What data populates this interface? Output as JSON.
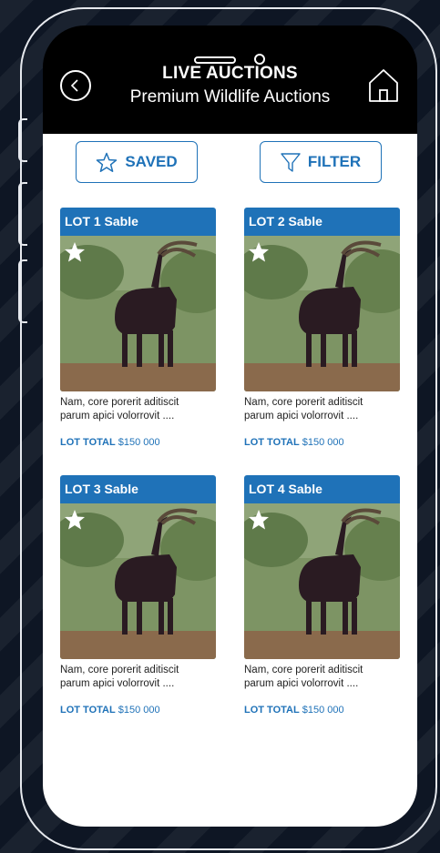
{
  "header": {
    "title": "LIVE AUCTIONS",
    "subtitle": "Premium Wildlife Auctions",
    "back_icon": "chevron-left-icon",
    "home_icon": "home-icon"
  },
  "toolbar": {
    "saved_label": "SAVED",
    "filter_label": "FILTER"
  },
  "lots": [
    {
      "title": "LOT 1 Sable",
      "desc_line1": "Nam, core porerit aditiscit",
      "desc_line2": "parum apici volorrovit ....",
      "total_label": "LOT TOTAL",
      "total_value": "$150 000"
    },
    {
      "title": "LOT 2 Sable",
      "desc_line1": "Nam, core porerit aditiscit",
      "desc_line2": "parum apici volorrovit ....",
      "total_label": "LOT TOTAL",
      "total_value": "$150 000"
    },
    {
      "title": "LOT 3 Sable",
      "desc_line1": "Nam, core porerit aditiscit",
      "desc_line2": "parum apici volorrovit ....",
      "total_label": "LOT TOTAL",
      "total_value": "$150 000"
    },
    {
      "title": "LOT 4 Sable",
      "desc_line1": "Nam, core porerit aditiscit",
      "desc_line2": "parum apici volorrovit ....",
      "total_label": "LOT TOTAL",
      "total_value": "$150 000"
    }
  ],
  "colors": {
    "accent": "#1f72b8",
    "header_bg": "#000000",
    "page_bg": "#0e1624"
  }
}
